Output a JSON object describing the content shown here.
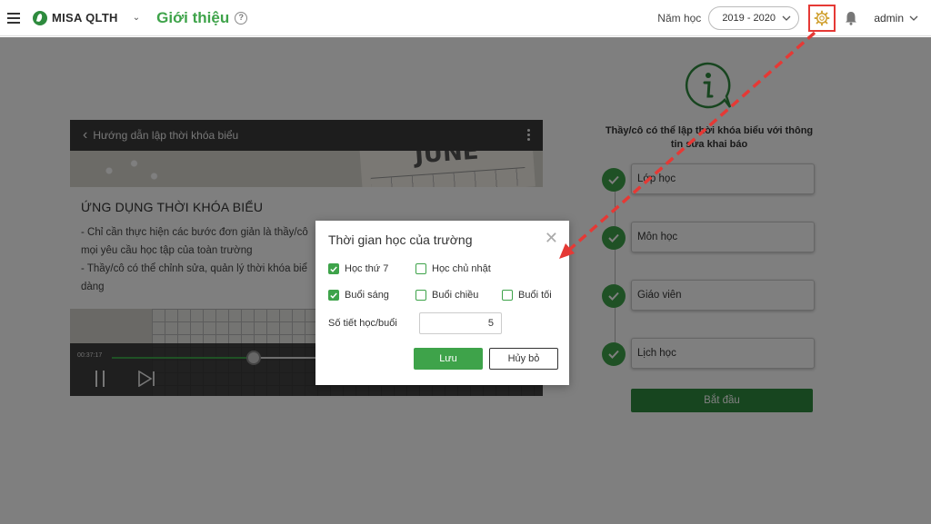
{
  "header": {
    "app_name": "MISA QLTH",
    "page_title": "Giới thiệu",
    "help": "?",
    "year_label": "Năm học",
    "year_value": "2019 - 2020",
    "user": "admin"
  },
  "video": {
    "title": "Hướng dẫn lập thời khóa biểu",
    "banner_text": "JUNE",
    "heading": "ỨNG DỤNG THỜI KHÓA BIỂU",
    "lines": [
      "- Chỉ cần thực hiện các bước đơn giản là thầy/cô",
      "mọi yêu cầu học tập của toàn trường",
      "- Thầy/cô có thể chỉnh sửa, quản lý thời khóa biể",
      "dàng"
    ],
    "time": "00:37:17",
    "progress_fraction": 0.33
  },
  "right_panel": {
    "info_text": "Thầy/cô có thể lập thời khóa biểu với thông tin sửa khai báo",
    "steps": [
      "Lớp học",
      "Môn học",
      "Giáo viên",
      "Lịch học"
    ],
    "start_button": "Bắt đầu"
  },
  "dialog": {
    "title": "Thời gian học của trường",
    "close": "✕",
    "checkboxes": [
      {
        "label": "Học thứ 7",
        "checked": true
      },
      {
        "label": "Học chủ nhật",
        "checked": false
      },
      {
        "label": "Buổi sáng",
        "checked": true
      },
      {
        "label": "Buổi chiều",
        "checked": false
      },
      {
        "label": "Buổi tối",
        "checked": false
      }
    ],
    "periods_label": "Số tiết học/buổi",
    "periods_value": "5",
    "save": "Lưu",
    "cancel": "Hủy bỏ"
  },
  "colors": {
    "brand_green": "#3ea34a",
    "dark_green": "#2e8b3e",
    "highlight_red": "#e53935"
  }
}
